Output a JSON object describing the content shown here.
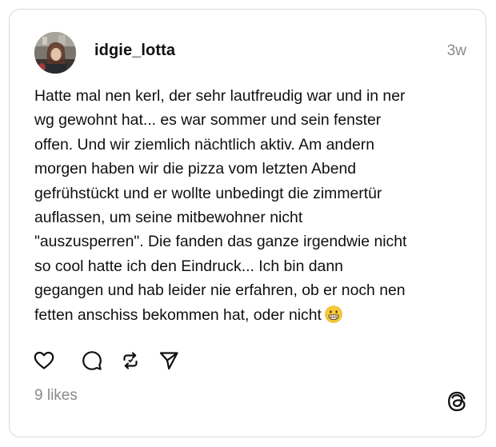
{
  "post": {
    "username": "idgie_lotta",
    "time": "3w",
    "text_lines": [
      "Hatte mal nen kerl, der sehr lautfreudig war und in ner",
      "wg gewohnt hat... es war sommer und  sein fenster",
      "offen. Und wir ziemlich nächtlich aktiv. Am andern",
      "morgen haben wir die pizza vom letzten Abend",
      "gefrühstückt und er wollte unbedingt die zimmertür",
      "auflassen, um seine mitbewohner nicht",
      "\"auszusperren\". Die fanden das ganze irgendwie nicht",
      "so cool hatte ich den Eindruck... Ich bin dann",
      "gegangen und hab leider nie erfahren, ob er noch nen",
      "fetten anschiss bekommen hat, oder nicht"
    ],
    "likes": "9 likes",
    "emoji": "grinning-face-emoji"
  },
  "actions": {
    "like_icon": "heart-icon",
    "comment_icon": "comment-bubble-icon",
    "repost_icon": "repost-icon",
    "share_icon": "send-icon"
  },
  "branding": {
    "logo_icon": "threads-logo-icon"
  },
  "colors": {
    "text": "#101010",
    "muted": "#8a8a8a",
    "border": "#d8d8d8",
    "background": "#ffffff"
  }
}
